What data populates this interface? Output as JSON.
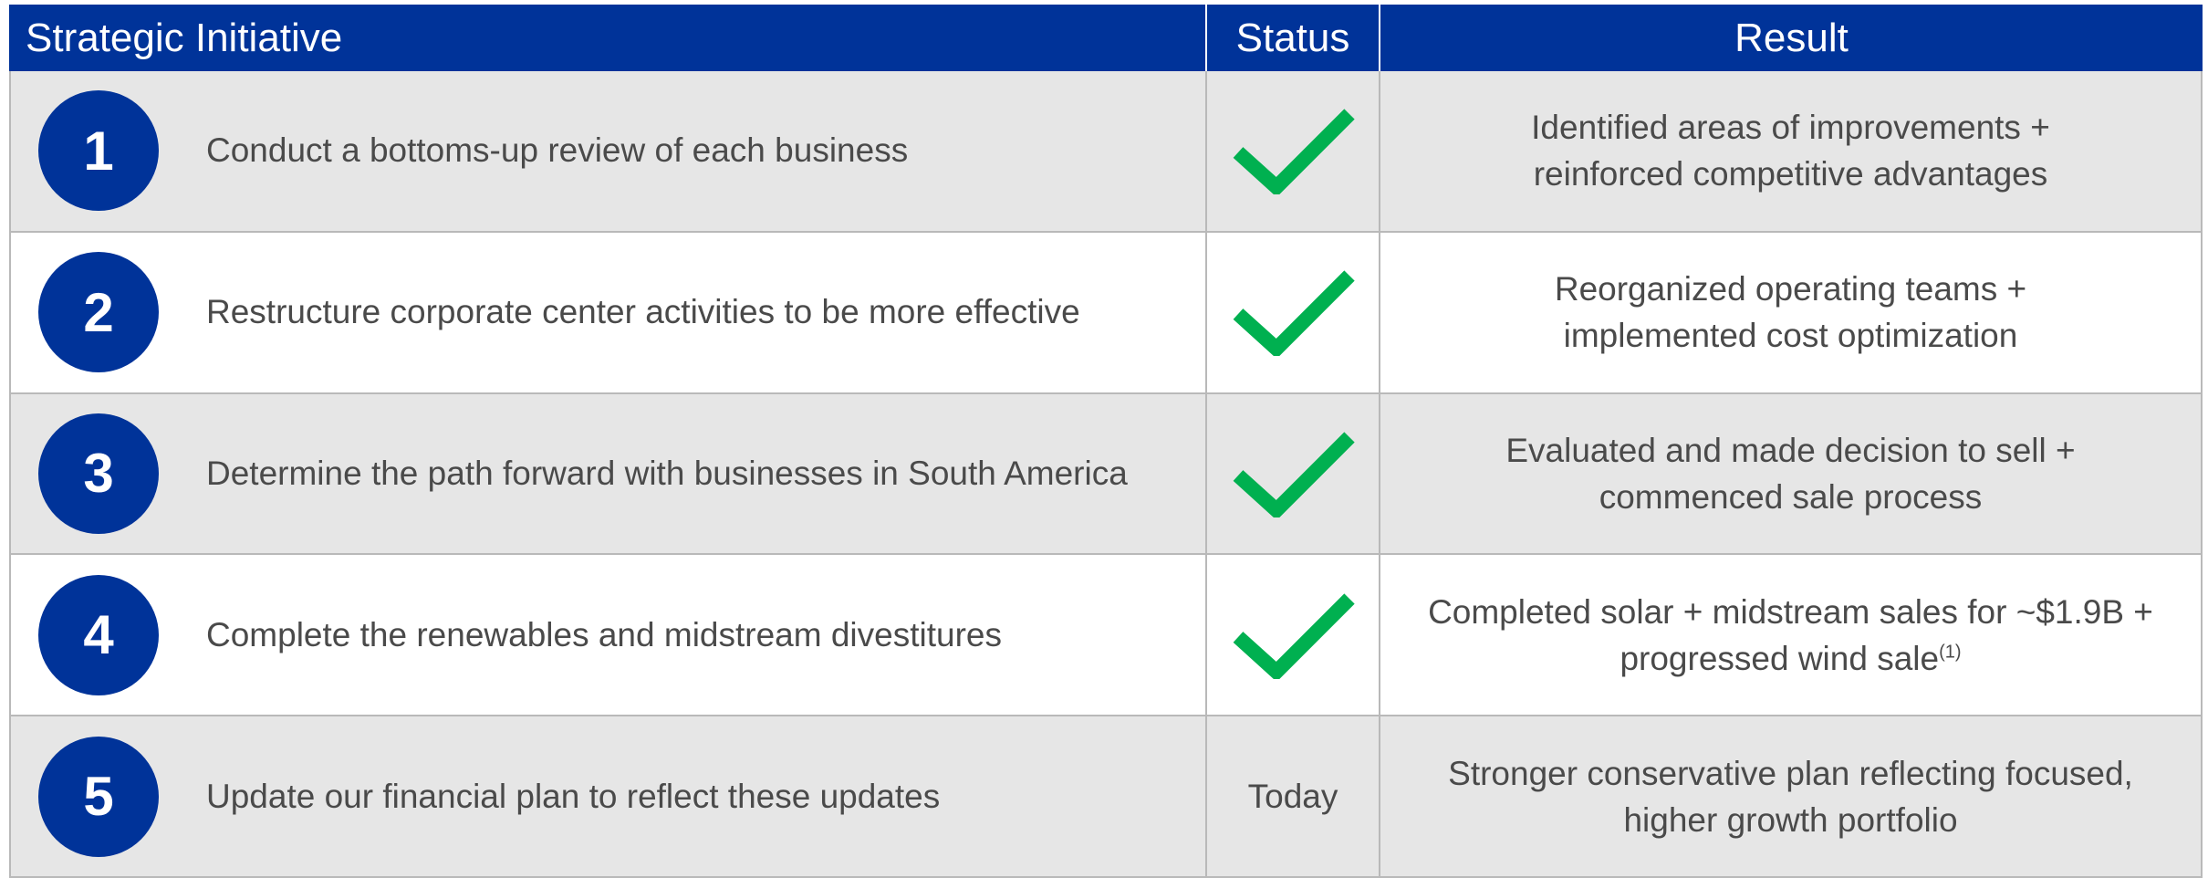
{
  "header": {
    "col1": "Strategic Initiative",
    "col2": "Status",
    "col3": "Result"
  },
  "rows": [
    {
      "number": "1",
      "initiative": "Conduct a bottoms-up review of each business",
      "status": "check",
      "result_line1": "Identified areas of improvements +",
      "result_line2": "reinforced competitive advantages"
    },
    {
      "number": "2",
      "initiative": "Restructure corporate center activities to be more effective",
      "status": "check",
      "result_line1": "Reorganized operating teams +",
      "result_line2": "implemented cost optimization"
    },
    {
      "number": "3",
      "initiative": "Determine the path forward with businesses in South America",
      "status": "check",
      "result_line1": "Evaluated and made decision to sell +",
      "result_line2": "commenced sale process"
    },
    {
      "number": "4",
      "initiative": "Complete the renewables and midstream divestitures",
      "status": "check",
      "result_line1": "Completed solar + midstream sales for ~$1.9B +",
      "result_line2": "progressed wind sale",
      "result_footnote": "(1)"
    },
    {
      "number": "5",
      "initiative": "Update our financial plan to reflect these updates",
      "status_text": "Today",
      "result_line1": "Stronger conservative plan reflecting focused,",
      "result_line2": "higher growth portfolio"
    }
  ],
  "colors": {
    "header_bg": "#003399",
    "number_circle": "#003399",
    "check_green": "#00b050",
    "row_shade": "#e6e6e6",
    "text": "#4a4a4a"
  },
  "icons": {
    "status_complete": "checkmark-icon"
  }
}
